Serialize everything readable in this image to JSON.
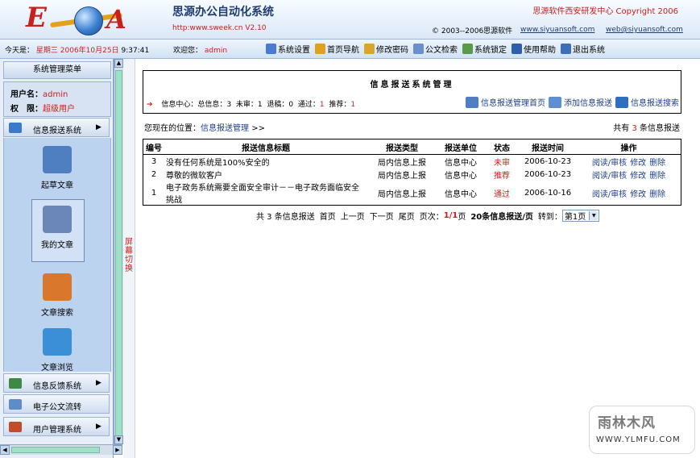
{
  "header": {
    "logo_left": "E",
    "logo_right": "A",
    "title": "思源办公自动化系统",
    "url_version": "http:www.sweek.cn V2.10",
    "brand": "思源软件西安研发中心 Copyright 2006",
    "copyright": "© 2003--2006思源软件",
    "site_link": "www.siyuansoft.com",
    "email_link": "web@siyuansoft.com"
  },
  "toolbar": {
    "today_label": "今天是：",
    "weekday": "星期三",
    "date": "2006年10月25日",
    "time": "9:37:41",
    "welcome_label": "欢迎您：",
    "user": "admin",
    "nav": [
      {
        "label": "系统设置",
        "icon": "settings-icon",
        "color": "#4a7bd0"
      },
      {
        "label": "首页导航",
        "icon": "home-icon",
        "color": "#e0a020"
      },
      {
        "label": "修改密码",
        "icon": "key-icon",
        "color": "#d9a62b"
      },
      {
        "label": "公文检索",
        "icon": "search-icon",
        "color": "#6a8fc9"
      },
      {
        "label": "系统锁定",
        "icon": "lock-icon",
        "color": "#5a9a48"
      },
      {
        "label": "使用帮助",
        "icon": "help-icon",
        "color": "#2f5fa8"
      },
      {
        "label": "退出系统",
        "icon": "exit-icon",
        "color": "#3b6fb6"
      }
    ]
  },
  "sidebar": {
    "title": "系统管理菜单",
    "user_label": "用户名：",
    "user_value": "admin",
    "role_label": "权　限：",
    "role_value": "超级用户",
    "menus": [
      {
        "label": "信息报送系统",
        "arrow": "▶",
        "icon": "info-report-icon",
        "color": "#3a7ac8"
      },
      {
        "label": "信息反馈系统",
        "arrow": "▶",
        "icon": "feedback-icon",
        "color": "#3d8a44"
      },
      {
        "label": "电子公文流转",
        "arrow": "",
        "icon": "document-flow-icon",
        "color": "#5d8cc8"
      },
      {
        "label": "用户管理系统",
        "arrow": "▶",
        "icon": "user-management-icon",
        "color": "#c44a2a"
      }
    ],
    "items": [
      {
        "label": "起草文章",
        "icon": "draft-icon",
        "color": "#4f7fc0"
      },
      {
        "label": "我的文章",
        "icon": "my-articles-icon",
        "color": "#6b86b8"
      },
      {
        "label": "文章搜索",
        "icon": "magnifier-icon",
        "color": "#d9782d"
      },
      {
        "label": "文章浏览",
        "icon": "ie-browser-icon",
        "color": "#3a8fd6"
      }
    ],
    "switch_label": "屏幕切换"
  },
  "main": {
    "box_title": "信息报送系统管理",
    "stats_prefix": "信息中心：总信息：",
    "stat_total": "3",
    "stat_unreviewed_label": "未审：",
    "stat_unreviewed": "1",
    "stat_rejected_label": "退稿：",
    "stat_rejected": "0",
    "stat_passed_label": "通过：",
    "stat_passed": "1",
    "stat_recommended_label": "推荐：",
    "stat_recommended": "1",
    "links": [
      {
        "label": "信息报送管理首页",
        "icon": "home-icon",
        "color": "#4f7fc0"
      },
      {
        "label": "添加信息报送",
        "icon": "add-icon",
        "color": "#5e8fd0"
      },
      {
        "label": "信息报送搜索",
        "icon": "search-icon",
        "color": "#2f6fc0"
      }
    ],
    "location_label": "您现在的位置：",
    "location_link": "信息报送管理",
    "location_arrow": ">>",
    "total_prefix": "共有",
    "total_count": "3",
    "total_suffix": "条信息报送"
  },
  "table": {
    "headers": [
      "编号",
      "报送信息标题",
      "报送类型",
      "报送单位",
      "状态",
      "报送时间",
      "操作"
    ],
    "rows": [
      {
        "id": "3",
        "title": "没有任何系统是100%安全的",
        "type": "局内信息上报",
        "unit": "信息中心",
        "status": "未审",
        "date": "2006-10-23"
      },
      {
        "id": "2",
        "title": "尊敬的微软客户",
        "type": "局内信息上报",
        "unit": "信息中心",
        "status": "推荐",
        "date": "2006-10-23"
      },
      {
        "id": "1",
        "title": "电子政务系统需要全面安全审计－－电子政务面临安全挑战",
        "type": "局内信息上报",
        "unit": "信息中心",
        "status": "通过",
        "date": "2006-10-16"
      }
    ],
    "actions": {
      "review": "阅读/审核",
      "edit": "修改",
      "delete": "删除"
    }
  },
  "pager": {
    "total_text": "共 3 条信息报送",
    "first": "首页",
    "prev": "上一页",
    "next": "下一页",
    "last": "尾页",
    "page_label": "页次：",
    "page_value": "1/1",
    "page_unit": "页",
    "per_page": "20条信息报送/页",
    "goto_label": "转到：",
    "select_value": "第1页"
  },
  "watermark": {
    "big": "雨林木风",
    "small": "WWW.YLMFU.COM"
  }
}
